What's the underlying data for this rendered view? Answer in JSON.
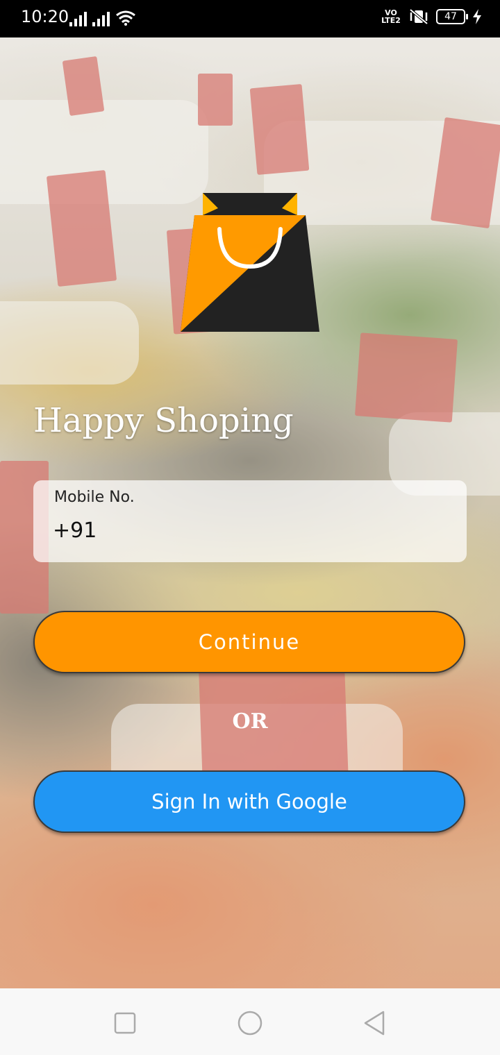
{
  "status_bar": {
    "time": "10:20",
    "network_label": "VO LTE2",
    "battery": "47"
  },
  "app": {
    "title": "Happy Shoping"
  },
  "login_form": {
    "mobile_label": "Mobile No.",
    "mobile_value": "+91",
    "continue_label": "Continue",
    "or_label": "OR",
    "google_label": "Sign In with Google"
  },
  "colors": {
    "continue_button": "#ff9500",
    "google_button": "#2196f3",
    "logo_orange": "#ff9a00",
    "logo_dark": "#222222"
  },
  "nav_bar": {
    "icons": [
      "recent-apps-icon",
      "home-icon",
      "back-icon"
    ]
  }
}
